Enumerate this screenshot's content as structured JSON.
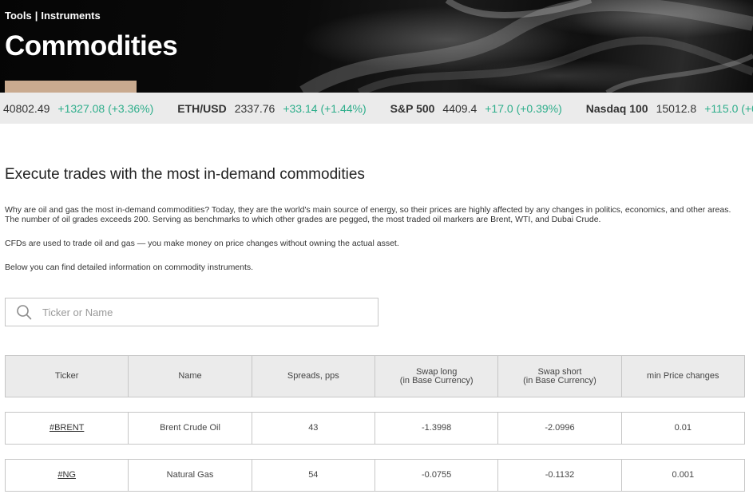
{
  "breadcrumb": {
    "tools": "Tools",
    "separator": "|",
    "instruments": "Instruments"
  },
  "page_title": "Commodities",
  "ticker_strip": [
    {
      "name": "",
      "price": "40802.49",
      "change": "+1327.08 (+3.36%)"
    },
    {
      "name": "ETH/USD",
      "price": "2337.76",
      "change": "+33.14 (+1.44%)"
    },
    {
      "name": "S&P 500",
      "price": "4409.4",
      "change": "+17.0 (+0.39%)"
    },
    {
      "name": "Nasdaq 100",
      "price": "15012.8",
      "change": "+115.0 (+0"
    }
  ],
  "section": {
    "heading": "Execute trades with the most in-demand commodities",
    "paragraph1": "Why are oil and gas the most in-demand commodities? Today, they are the world's main source of energy, so their prices are highly affected by any changes in politics, economics, and other areas. The number of oil grades exceeds 200. Serving as benchmarks to which other grades are pegged, the most traded oil markers are Brent, WTI, and Dubai Crude.",
    "paragraph2": "CFDs are used to trade oil and gas — you make money on price changes without owning the actual asset.",
    "paragraph3": "Below you can find detailed information on commodity instruments."
  },
  "search": {
    "placeholder": "Ticker or Name",
    "value": "",
    "icon": "search-icon"
  },
  "table": {
    "headers": {
      "ticker": "Ticker",
      "name": "Name",
      "spreads": "Spreads, pps",
      "swap_long_1": "Swap long",
      "swap_long_2": "(in Base Currency)",
      "swap_short_1": "Swap short",
      "swap_short_2": "(in Base Currency)",
      "min_price": "min Price changes"
    },
    "rows": [
      {
        "ticker": "#BRENT",
        "name": "Brent Crude Oil",
        "spreads": "43",
        "swap_long": "-1.3998",
        "swap_short": "-2.0996",
        "min_price": "0.01"
      },
      {
        "ticker": "#NG",
        "name": "Natural Gas",
        "spreads": "54",
        "swap_long": "-0.0755",
        "swap_short": "-0.1132",
        "min_price": "0.001"
      }
    ]
  },
  "colors": {
    "accent": "#c9aa8f",
    "positive": "#2eae8b",
    "strip_bg": "#ebebeb",
    "border": "#c6c6c6"
  }
}
